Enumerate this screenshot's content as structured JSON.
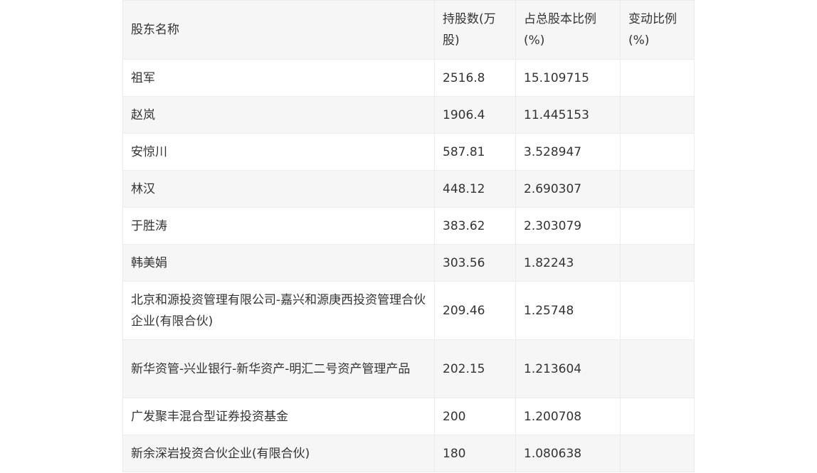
{
  "table": {
    "headers": [
      "股东名称",
      "持股数(万股)",
      "占总股本比例(%)",
      "变动比例(%)"
    ],
    "rows": [
      [
        "祖军",
        "2516.8",
        "15.109715",
        ""
      ],
      [
        "赵岚",
        "1906.4",
        "11.445153",
        ""
      ],
      [
        "安惊川",
        "587.81",
        "3.528947",
        ""
      ],
      [
        "林汉",
        "448.12",
        "2.690307",
        ""
      ],
      [
        "于胜涛",
        "383.62",
        "2.303079",
        ""
      ],
      [
        "韩美娟",
        "303.56",
        "1.82243",
        ""
      ],
      [
        "北京和源投资管理有限公司-嘉兴和源庚西投资管理合伙企业(有限合伙)",
        "209.46",
        "1.25748",
        ""
      ],
      [
        "新华资管-兴业银行-新华资产-明汇二号资产管理产品",
        "202.15",
        "1.213604",
        ""
      ],
      [
        "广发聚丰混合型证券投资基金",
        "200",
        "1.200708",
        ""
      ],
      [
        "新余深岩投资合伙企业(有限合伙)",
        "180",
        "1.080638",
        ""
      ]
    ]
  }
}
